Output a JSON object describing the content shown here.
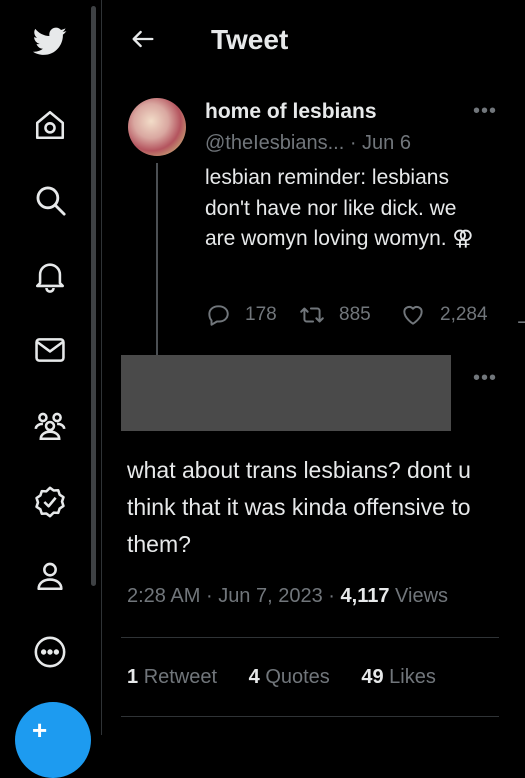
{
  "header": {
    "title": "Tweet"
  },
  "sidebar": {
    "items": [
      "twitter-logo",
      "home",
      "search",
      "notifications",
      "messages",
      "communities",
      "verified",
      "profile",
      "more"
    ]
  },
  "quoted_tweet": {
    "author_name": "home of lesbians",
    "handle": "@theIesbians...",
    "date": "· Jun 6",
    "text": "lesbian reminder: lesbians don't have nor like dick. we are womyn loving womyn. ⚢",
    "replies": "178",
    "retweets": "885",
    "likes": "2,284"
  },
  "reply": {
    "text": "what about trans lesbians? dont u think that it was kinda offensive to them?",
    "time": "2:28 AM",
    "date": "Jun 7, 2023",
    "views_count": "4,117",
    "views_label": "Views",
    "sep": "·"
  },
  "stats": {
    "retweets_count": "1",
    "retweets_label": "Retweet",
    "quotes_count": "4",
    "quotes_label": "Quotes",
    "likes_count": "49",
    "likes_label": "Likes"
  },
  "colors": {
    "accent": "#1d9bf0",
    "text": "#e7e9ea",
    "muted": "#71767b",
    "bg": "#000000"
  }
}
